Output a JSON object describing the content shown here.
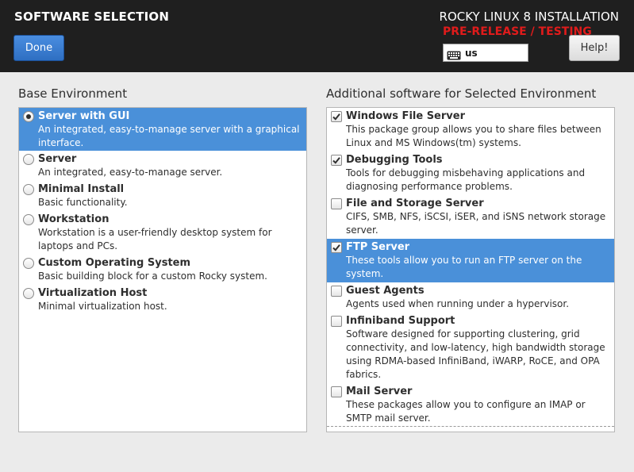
{
  "header": {
    "page_title": "SOFTWARE SELECTION",
    "done_label": "Done",
    "product_title": "ROCKY LINUX 8 INSTALLATION",
    "prerelease_label": "PRE-RELEASE / TESTING",
    "keyboard_layout": "us",
    "help_label": "Help!"
  },
  "base": {
    "title": "Base Environment",
    "items": [
      {
        "name": "Server with GUI",
        "desc": "An integrated, easy-to-manage server with a graphical interface.",
        "selected": true
      },
      {
        "name": "Server",
        "desc": "An integrated, easy-to-manage server.",
        "selected": false
      },
      {
        "name": "Minimal Install",
        "desc": "Basic functionality.",
        "selected": false
      },
      {
        "name": "Workstation",
        "desc": "Workstation is a user-friendly desktop system for laptops and PCs.",
        "selected": false
      },
      {
        "name": "Custom Operating System",
        "desc": "Basic building block for a custom Rocky system.",
        "selected": false
      },
      {
        "name": "Virtualization Host",
        "desc": "Minimal virtualization host.",
        "selected": false
      }
    ]
  },
  "additional": {
    "title": "Additional software for Selected Environment",
    "items": [
      {
        "name": "Windows File Server",
        "desc": "This package group allows you to share files between Linux and MS Windows(tm) systems.",
        "checked": true,
        "highlighted": false
      },
      {
        "name": "Debugging Tools",
        "desc": "Tools for debugging misbehaving applications and diagnosing performance problems.",
        "checked": true,
        "highlighted": false
      },
      {
        "name": "File and Storage Server",
        "desc": "CIFS, SMB, NFS, iSCSI, iSER, and iSNS network storage server.",
        "checked": false,
        "highlighted": false
      },
      {
        "name": "FTP Server",
        "desc": "These tools allow you to run an FTP server on the system.",
        "checked": true,
        "highlighted": true
      },
      {
        "name": "Guest Agents",
        "desc": "Agents used when running under a hypervisor.",
        "checked": false,
        "highlighted": false
      },
      {
        "name": "Infiniband Support",
        "desc": "Software designed for supporting clustering, grid connectivity, and low-latency, high bandwidth storage using RDMA-based InfiniBand, iWARP, RoCE, and OPA fabrics.",
        "checked": false,
        "highlighted": false
      },
      {
        "name": "Mail Server",
        "desc": "These packages allow you to configure an IMAP or SMTP mail server.",
        "checked": false,
        "highlighted": false
      }
    ]
  },
  "colors": {
    "header_bg": "#1f1f1f",
    "accent_blue": "#4a90d9",
    "prerelease_red": "#e01b1b"
  },
  "icons": {
    "keyboard": "keyboard-icon",
    "radio": "radio-button",
    "check": "checkmark-icon"
  }
}
